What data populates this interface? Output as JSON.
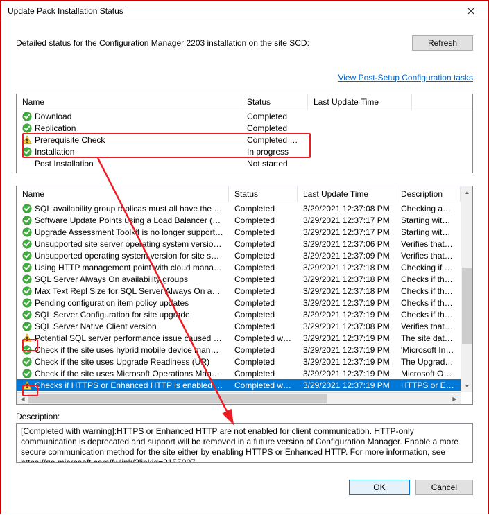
{
  "window": {
    "title": "Update Pack Installation Status"
  },
  "header": {
    "detail_text": "Detailed status for the Configuration Manager 2203 installation on the site SCD:",
    "refresh_label": "Refresh",
    "post_setup_link": "View Post-Setup Configuration tasks"
  },
  "top_grid": {
    "columns": {
      "name": "Name",
      "status": "Status",
      "time": "Last Update Time"
    },
    "rows": [
      {
        "icon": "ok",
        "name": "Download",
        "status": "Completed",
        "time": ""
      },
      {
        "icon": "ok",
        "name": "Replication",
        "status": "Completed",
        "time": ""
      },
      {
        "icon": "warn",
        "name": "Prerequisite Check",
        "status": "Completed with ...",
        "time": ""
      },
      {
        "icon": "ok",
        "name": "Installation",
        "status": "In progress",
        "time": ""
      },
      {
        "icon": "none",
        "name": "Post Installation",
        "status": "Not started",
        "time": ""
      }
    ]
  },
  "bottom_grid": {
    "columns": {
      "name": "Name",
      "status": "Status",
      "time": "Last Update Time",
      "desc": "Description"
    },
    "rows": [
      {
        "icon": "ok",
        "name": "SQL availability group replicas must all have the same se...",
        "status": "Completed",
        "time": "3/29/2021 12:37:08 PM",
        "desc": "Checking availabili"
      },
      {
        "icon": "ok",
        "name": "Software Update Points using a Load Balancer (NLB/HL...",
        "status": "Completed",
        "time": "3/29/2021 12:37:17 PM",
        "desc": "Starting with versic"
      },
      {
        "icon": "ok",
        "name": "Upgrade Assessment Toolkit is no longer supported.",
        "status": "Completed",
        "time": "3/29/2021 12:37:17 PM",
        "desc": "Starting with versic"
      },
      {
        "icon": "ok",
        "name": "Unsupported site server operating system version for Set...",
        "status": "Completed",
        "time": "3/29/2021 12:37:06 PM",
        "desc": "Verifies that the site"
      },
      {
        "icon": "ok",
        "name": "Unsupported operating system version for site system role",
        "status": "Completed",
        "time": "3/29/2021 12:37:09 PM",
        "desc": "Verifies that the site"
      },
      {
        "icon": "ok",
        "name": "Using HTTP management point with cloud management...",
        "status": "Completed",
        "time": "3/29/2021 12:37:18 PM",
        "desc": "Checking if HTTP"
      },
      {
        "icon": "ok",
        "name": "SQL Server Always On availability groups",
        "status": "Completed",
        "time": "3/29/2021 12:37:18 PM",
        "desc": "Checks if the spec"
      },
      {
        "icon": "ok",
        "name": "Max Text Repl Size for SQL Server Always On availabilit...",
        "status": "Completed",
        "time": "3/29/2021 12:37:18 PM",
        "desc": "Checks if the max"
      },
      {
        "icon": "ok",
        "name": "Pending configuration item policy updates",
        "status": "Completed",
        "time": "3/29/2021 12:37:19 PM",
        "desc": "Checks if there are"
      },
      {
        "icon": "ok",
        "name": "SQL Server Configuration for site upgrade",
        "status": "Completed",
        "time": "3/29/2021 12:37:19 PM",
        "desc": "Checks if the spec"
      },
      {
        "icon": "ok",
        "name": "SQL Server Native Client version",
        "status": "Completed",
        "time": "3/29/2021 12:37:08 PM",
        "desc": "Verifies that the ve"
      },
      {
        "icon": "warn",
        "name": "Potential SQL server performance issue caused by chan...",
        "status": "Completed with ...",
        "time": "3/29/2021 12:37:19 PM",
        "desc": "The site database"
      },
      {
        "icon": "ok",
        "name": "Check if the site uses hybrid mobile device management ...",
        "status": "Completed",
        "time": "3/29/2021 12:37:19 PM",
        "desc": "'Microsoft Intune S"
      },
      {
        "icon": "ok",
        "name": "Check if the site uses Upgrade Readiness (UR)",
        "status": "Completed",
        "time": "3/29/2021 12:37:19 PM",
        "desc": "The Upgrade Rea"
      },
      {
        "icon": "ok",
        "name": "Check if the site uses Microsoft Operations Management...",
        "status": "Completed",
        "time": "3/29/2021 12:37:19 PM",
        "desc": "Microsoft Operatio"
      },
      {
        "icon": "warn",
        "name": "Checks if HTTPS or Enhanced HTTP is enabled for site ...",
        "status": "Completed with ...",
        "time": "3/29/2021 12:37:19 PM",
        "desc": "HTTPS or Enhanc",
        "selected": true
      }
    ]
  },
  "description": {
    "label": "Description:",
    "text": "[Completed with warning]:HTTPS or Enhanced HTTP are not enabled for client communication. HTTP-only communication is deprecated and support will be removed in a future version of Configuration Manager. Enable a more secure communication method for the site either by enabling HTTPS or Enhanced HTTP. For more information, see https://go.microsoft.com/fwlink/?linkid=2155007."
  },
  "footer": {
    "ok_label": "OK",
    "cancel_label": "Cancel"
  }
}
